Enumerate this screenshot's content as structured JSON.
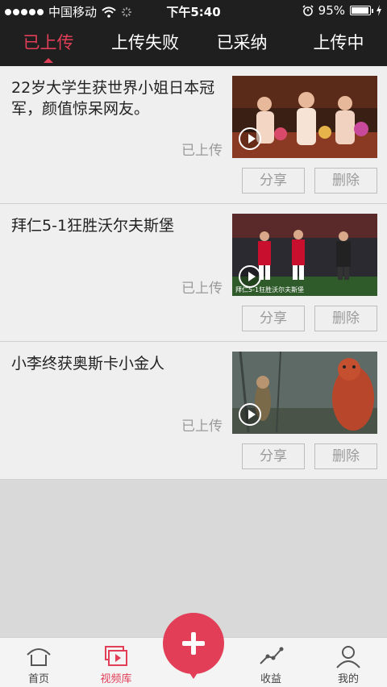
{
  "status_bar": {
    "carrier": "中国移动",
    "time": "下午5:40",
    "battery": "95%",
    "battery_level": 0.95
  },
  "tabs": [
    {
      "label": "已上传",
      "active": true
    },
    {
      "label": "上传失败",
      "active": false
    },
    {
      "label": "已采纳",
      "active": false
    },
    {
      "label": "上传中",
      "active": false
    }
  ],
  "videos": [
    {
      "title": "22岁大学生获世界小姐日本冠军，颜值惊呆网友。",
      "status": "已上传",
      "share": "分享",
      "delete": "删除",
      "thumb_caption": ""
    },
    {
      "title": "拜仁5-1狂胜沃尔夫斯堡",
      "status": "已上传",
      "share": "分享",
      "delete": "删除",
      "thumb_caption": "拜仁5-1狂胜沃尔夫斯堡"
    },
    {
      "title": "小李终获奥斯卡小金人",
      "status": "已上传",
      "share": "分享",
      "delete": "删除",
      "thumb_caption": ""
    }
  ],
  "bottom_nav": {
    "home": "首页",
    "videos": "视频库",
    "income": "收益",
    "mine": "我的"
  },
  "colors": {
    "accent": "#e23e57",
    "header_bg": "#1f1f1f"
  }
}
